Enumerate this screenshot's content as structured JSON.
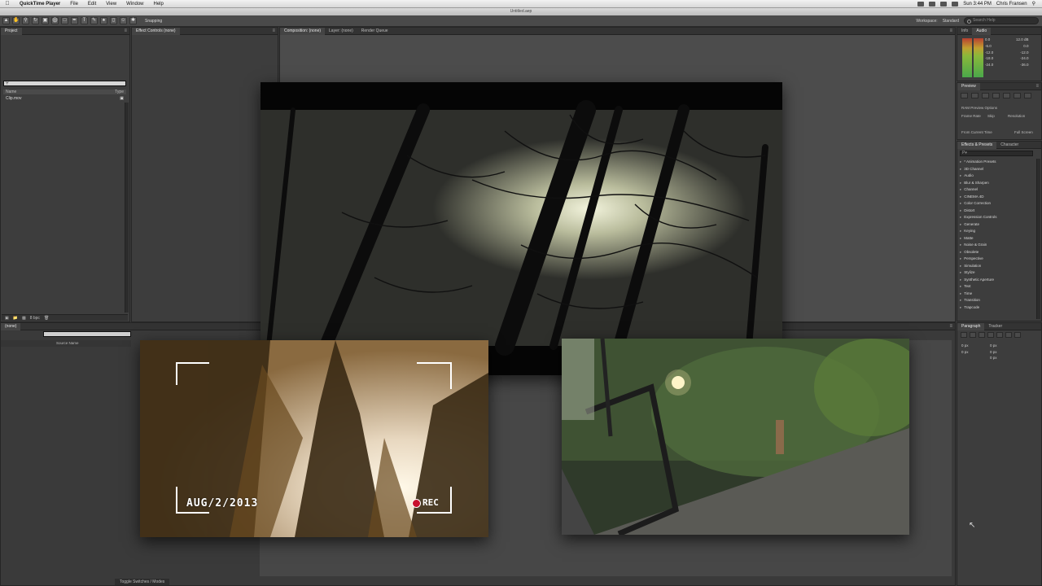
{
  "menubar": {
    "app": "QuickTime Player",
    "items": [
      "File",
      "Edit",
      "View",
      "Window",
      "Help"
    ],
    "clock": "Sun 3:44 PM",
    "user": "Chris Fransen"
  },
  "window": {
    "title": "Untitled.aep"
  },
  "toolbar": {
    "snapping": "Snapping",
    "workspace_label": "Workspace:",
    "workspace_value": "Standard",
    "search_placeholder": "Search Help"
  },
  "project": {
    "tab": "Project",
    "col_name": "Name",
    "col_type": "Type",
    "item": "Clip.mov",
    "footer_bpc": "8 bpc"
  },
  "effect_controls": {
    "tab": "Effect Controls (none)"
  },
  "composition": {
    "tab": "Composition: (none)",
    "layer_tab": "Layer: (none)",
    "render_tab": "Render Queue"
  },
  "audio": {
    "tab_info": "Info",
    "tab_audio": "Audio",
    "left_vals": [
      "0.0",
      "-6.0",
      "-12.0",
      "-18.0",
      "-24.0"
    ],
    "right_vals": [
      "12.0 dB",
      "0.0",
      "-12.0",
      "-24.0",
      "-36.0"
    ]
  },
  "preview": {
    "tab": "Preview",
    "ram_options": "RAM Preview Options",
    "frame_rate": "Frame Rate",
    "skip": "Skip",
    "resolution": "Resolution",
    "from_current": "From Current Time",
    "full_screen": "Full Screen"
  },
  "effects": {
    "tab": "Effects & Presets",
    "tab2": "Character",
    "search": "P▾",
    "items": [
      "* Animation Presets",
      "3D Channel",
      "Audio",
      "Blur & Sharpen",
      "Channel",
      "CINEMA 4D",
      "Color Correction",
      "Distort",
      "Expression Controls",
      "Generate",
      "Keying",
      "Matte",
      "Noise & Grain",
      "Obsolete",
      "Perspective",
      "Simulation",
      "Stylize",
      "Synthetic Aperture",
      "Text",
      "Time",
      "Transition",
      "Trapcode"
    ]
  },
  "paragraph": {
    "tab": "Paragraph",
    "tab2": "Tracker",
    "vals": [
      "0 px",
      "0 px",
      "0 px",
      "0 px",
      "0 px"
    ]
  },
  "timeline": {
    "tab": "(none)",
    "col_source": "Source Name",
    "footer": "Toggle Switches / Modes"
  },
  "frames": {
    "date_overlay": "AUG/2/2013",
    "rec_overlay": "REC"
  }
}
